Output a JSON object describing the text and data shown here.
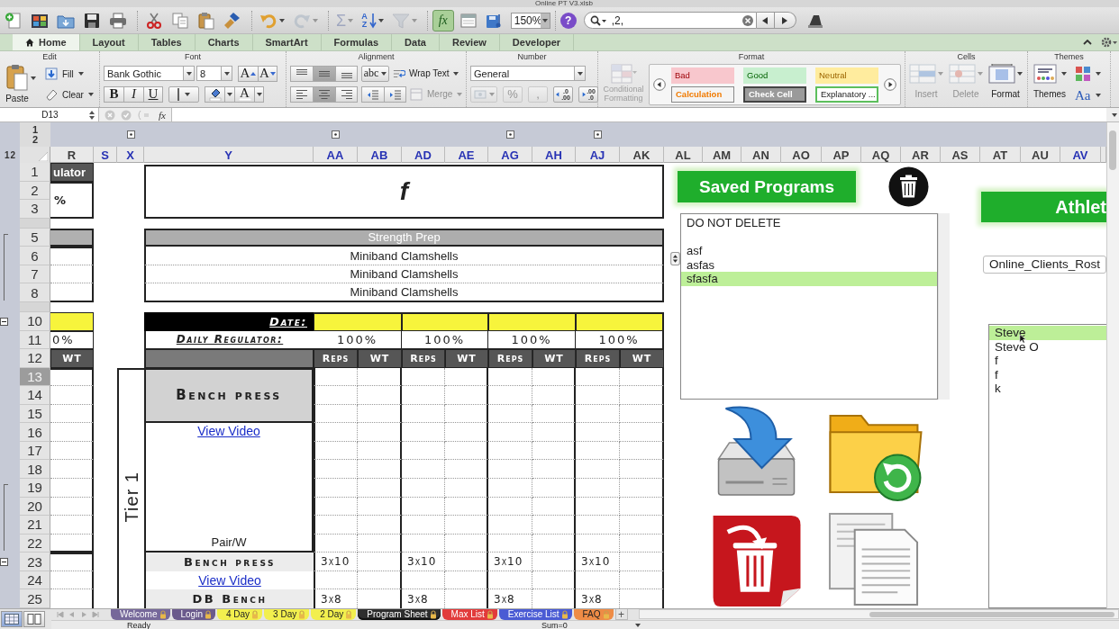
{
  "window": {
    "title": "Online PT V3.xlsb"
  },
  "toolbar": {
    "buttons": [
      {
        "kind": "new",
        "disabled": false,
        "on": false
      },
      {
        "kind": "gallery",
        "disabled": false,
        "on": false
      },
      {
        "kind": "open",
        "disabled": false,
        "on": false
      },
      {
        "kind": "save",
        "disabled": false,
        "on": false
      },
      {
        "kind": "print",
        "disabled": false,
        "on": false
      },
      {
        "kind": "cut",
        "disabled": false,
        "on": false
      },
      {
        "kind": "copy",
        "disabled": false,
        "on": false
      },
      {
        "kind": "paste",
        "disabled": false,
        "on": false
      },
      {
        "kind": "brush",
        "disabled": false,
        "on": false
      },
      {
        "kind": "undo",
        "disabled": false,
        "on": false
      },
      {
        "kind": "redo",
        "disabled": true,
        "on": false
      },
      {
        "kind": "sum",
        "label": "Σ",
        "disabled": true,
        "on": false
      },
      {
        "kind": "sort",
        "labels": [
          "A",
          "Z"
        ],
        "disabled": false,
        "on": false
      },
      {
        "kind": "filter",
        "disabled": true,
        "on": false
      },
      {
        "kind": "function",
        "label": "fx",
        "disabled": false,
        "on": true
      },
      {
        "kind": "toolbox",
        "disabled": false,
        "on": false
      },
      {
        "kind": "media",
        "disabled": false,
        "on": false
      }
    ],
    "zoom": "150%",
    "help": "?",
    "search": {
      "value": ",2,"
    },
    "end_buttons": [
      {
        "kind": "macro",
        "disabled": false,
        "on": false
      }
    ]
  },
  "ribbon_tabs": [
    {
      "label": "Home",
      "selected": true
    },
    {
      "label": "Layout",
      "selected": false
    },
    {
      "label": "Tables",
      "selected": false
    },
    {
      "label": "Charts",
      "selected": false
    },
    {
      "label": "SmartArt",
      "selected": false
    },
    {
      "label": "Formulas",
      "selected": false
    },
    {
      "label": "Data",
      "selected": false
    },
    {
      "label": "Review",
      "selected": false
    },
    {
      "label": "Developer",
      "selected": false
    }
  ],
  "ribbon": {
    "edit": {
      "title": "Edit",
      "paste": "Paste",
      "fill": "Fill",
      "clear": "Clear"
    },
    "font": {
      "title": "Font",
      "family": "Bank Gothic",
      "size": "8",
      "grow": "A",
      "shrink": "A",
      "bold": "B",
      "italic": "I",
      "underline": "U",
      "foreground": "A"
    },
    "alignment": {
      "title": "Alignment",
      "vertical": [
        {
          "kind": "top",
          "selected": false
        },
        {
          "kind": "middle",
          "selected": true
        },
        {
          "kind": "bottom",
          "selected": false
        }
      ],
      "horizontal": [
        {
          "kind": "left",
          "selected": false
        },
        {
          "kind": "center",
          "selected": true
        },
        {
          "kind": "right",
          "selected": false
        }
      ],
      "orientation": "abc",
      "wrap": "Wrap Text",
      "merge": {
        "label": "Merge",
        "disabled": true
      }
    },
    "number": {
      "title": "Number",
      "format": "General",
      "currency": {
        "disabled": true
      },
      "percent": {
        "label": "%",
        "disabled": true
      },
      "comma": {
        "label": ",",
        "disabled": true
      },
      "decimals": [
        {
          "top": ".0",
          "bottom": ".00"
        },
        {
          "top": ".00",
          "bottom": ".0"
        }
      ]
    },
    "format": {
      "title": "Format",
      "conditional": {
        "label": "Conditional Formatting",
        "disabled": true
      },
      "styles": [
        {
          "label": "Bad",
          "kind": "bad"
        },
        {
          "label": "Good",
          "kind": "good"
        },
        {
          "label": "Neutral",
          "kind": "neutral"
        },
        {
          "label": "Calculation",
          "kind": "calculation"
        },
        {
          "label": "Check Cell",
          "kind": "check"
        },
        {
          "label": "Explanatory ...",
          "kind": "explanatory"
        }
      ]
    },
    "cells": {
      "title": "Cells",
      "buttons": [
        {
          "kind": "insert",
          "label": "Insert",
          "disabled": true
        },
        {
          "kind": "delete",
          "label": "Delete",
          "disabled": true
        },
        {
          "kind": "format",
          "label": "Format",
          "disabled": false
        }
      ]
    },
    "themes": {
      "title": "Themes",
      "themes": "Themes",
      "fonts": "Aa"
    }
  },
  "formula_bar": {
    "name_box": "D13",
    "fx": "fx"
  },
  "sheet": {
    "column_levels": [
      "1",
      "2"
    ],
    "row_levels": [
      "1",
      "2"
    ],
    "columns": [
      {
        "label": "R",
        "highlighted": false,
        "outline_button": false
      },
      {
        "label": "S",
        "highlighted": true,
        "outline_button": false
      },
      {
        "label": "X",
        "highlighted": true,
        "outline_button": true
      },
      {
        "label": "Y",
        "highlighted": true,
        "outline_button": false
      },
      {
        "label": "AA",
        "highlighted": true,
        "outline_button": true
      },
      {
        "label": "AB",
        "highlighted": true,
        "outline_button": false
      },
      {
        "label": "AD",
        "highlighted": true,
        "outline_button": false
      },
      {
        "label": "AE",
        "highlighted": true,
        "outline_button": false
      },
      {
        "label": "AG",
        "highlighted": true,
        "outline_button": true
      },
      {
        "label": "AH",
        "highlighted": true,
        "outline_button": false
      },
      {
        "label": "AJ",
        "highlighted": true,
        "outline_button": true
      },
      {
        "label": "AK",
        "highlighted": false,
        "outline_button": false
      },
      {
        "label": "AL",
        "highlighted": false,
        "outline_button": false
      },
      {
        "label": "AM",
        "highlighted": false,
        "outline_button": false
      },
      {
        "label": "AN",
        "highlighted": false,
        "outline_button": false
      },
      {
        "label": "AO",
        "highlighted": false,
        "outline_button": false
      },
      {
        "label": "AP",
        "highlighted": false,
        "outline_button": false
      },
      {
        "label": "AQ",
        "highlighted": false,
        "outline_button": false
      },
      {
        "label": "AR",
        "highlighted": false,
        "outline_button": false
      },
      {
        "label": "AS",
        "highlighted": false,
        "outline_button": false
      },
      {
        "label": "AT",
        "highlighted": false,
        "outline_button": false
      },
      {
        "label": "AU",
        "highlighted": false,
        "outline_button": false
      },
      {
        "label": "AV",
        "highlighted": true,
        "outline_button": false
      }
    ],
    "rows": [
      {
        "label": "1",
        "selected": false,
        "hidden": false,
        "grouped": false,
        "collapse_button": false
      },
      {
        "label": "2",
        "selected": false,
        "hidden": false,
        "grouped": false,
        "collapse_button": false
      },
      {
        "label": "3",
        "selected": false,
        "hidden": false,
        "grouped": false,
        "collapse_button": false
      },
      {
        "selected": false,
        "hidden": true,
        "grouped": false,
        "collapse_button": false
      },
      {
        "label": "5",
        "selected": false,
        "hidden": false,
        "grouped": true,
        "collapse_button": false
      },
      {
        "label": "6",
        "selected": false,
        "hidden": false,
        "grouped": true,
        "collapse_button": false
      },
      {
        "label": "7",
        "selected": false,
        "hidden": false,
        "grouped": true,
        "collapse_button": false
      },
      {
        "label": "8",
        "selected": false,
        "hidden": false,
        "grouped": true,
        "collapse_button": false
      },
      {
        "selected": false,
        "hidden": true,
        "grouped": false,
        "collapse_button": false
      },
      {
        "label": "10",
        "selected": false,
        "hidden": false,
        "grouped": false,
        "collapse_button": true
      },
      {
        "label": "11",
        "selected": false,
        "hidden": false,
        "grouped": false,
        "collapse_button": false
      },
      {
        "label": "12",
        "selected": false,
        "hidden": false,
        "grouped": false,
        "collapse_button": false
      },
      {
        "label": "13",
        "selected": true,
        "hidden": false,
        "grouped": false,
        "collapse_button": false
      },
      {
        "label": "14",
        "selected": false,
        "hidden": false,
        "grouped": false,
        "collapse_button": false
      },
      {
        "label": "15",
        "selected": false,
        "hidden": false,
        "grouped": false,
        "collapse_button": false
      },
      {
        "label": "16",
        "selected": false,
        "hidden": false,
        "grouped": false,
        "collapse_button": false
      },
      {
        "label": "17",
        "selected": false,
        "hidden": false,
        "grouped": false,
        "collapse_button": false
      },
      {
        "label": "18",
        "selected": false,
        "hidden": false,
        "grouped": false,
        "collapse_button": false
      },
      {
        "label": "19",
        "selected": false,
        "hidden": false,
        "grouped": true,
        "collapse_button": false
      },
      {
        "label": "20",
        "selected": false,
        "hidden": false,
        "grouped": true,
        "collapse_button": false
      },
      {
        "label": "21",
        "selected": false,
        "hidden": false,
        "grouped": true,
        "collapse_button": false
      },
      {
        "label": "22",
        "selected": false,
        "hidden": false,
        "grouped": true,
        "collapse_button": false
      },
      {
        "label": "23",
        "selected": false,
        "hidden": false,
        "grouped": false,
        "collapse_button": true
      },
      {
        "label": "24",
        "selected": false,
        "hidden": false,
        "grouped": false,
        "collapse_button": false
      },
      {
        "label": "25",
        "selected": false,
        "hidden": false,
        "grouped": false,
        "collapse_button": false
      }
    ],
    "regulator": {
      "header": "ulator",
      "value": "%",
      "daily": "0%",
      "column_header": "WT"
    },
    "title_cell": "f",
    "warmup": {
      "header": "Strength Prep",
      "items": [
        "Miniband Clamshells",
        "Miniband Clamshells",
        "Miniband Clamshells"
      ]
    },
    "date_label": "Date:",
    "regulator_label": "Daily Regulator:",
    "weeks": [
      {
        "regulator": "100%",
        "columns": [
          "Reps",
          "WT"
        ]
      },
      {
        "regulator": "100%",
        "columns": [
          "Reps",
          "WT"
        ]
      },
      {
        "regulator": "100%",
        "columns": [
          "Reps",
          "WT"
        ]
      },
      {
        "regulator": "100%",
        "columns": [
          "Reps",
          "WT"
        ]
      }
    ],
    "tier": {
      "label": "Tier 1",
      "exercises": [
        {
          "kind": "header",
          "name": "Bench press",
          "link": "View Video",
          "note": "Pair/W"
        },
        {
          "kind": "row",
          "name": "Bench press",
          "sets": [
            "3x10",
            "3x10",
            "3x10",
            "3x10"
          ]
        },
        {
          "kind": "link",
          "link": "View Video"
        },
        {
          "kind": "row",
          "name": "DB Bench",
          "sets": [
            "3x8",
            "3x8",
            "3x8",
            "3x8"
          ]
        }
      ]
    }
  },
  "objects": {
    "saved_programs": {
      "label": "Saved Programs"
    },
    "programs_list": {
      "items": [
        {
          "kind": "text",
          "label": "DO NOT DELETE",
          "selected": false
        },
        {
          "kind": "blank",
          "selected": false
        },
        {
          "kind": "text",
          "label": "asf",
          "selected": false
        },
        {
          "kind": "text",
          "label": "asfas",
          "selected": false
        },
        {
          "kind": "text",
          "label": "sfasfa",
          "selected": true
        }
      ]
    },
    "athletes": {
      "label": "Athlet"
    },
    "roster_combo": {
      "value": "Online_Clients_Rost"
    },
    "athletes_list": {
      "items": [
        {
          "label": "Steve",
          "selected": true
        },
        {
          "label": "Steve O",
          "selected": false
        },
        {
          "label": "f",
          "selected": false
        },
        {
          "label": "f",
          "selected": false
        },
        {
          "label": "k",
          "selected": false
        }
      ]
    }
  },
  "sheet_tabs": {
    "tabs": [
      {
        "label": "Welcome",
        "color": "#76689a",
        "selected": false,
        "locked": true
      },
      {
        "label": "Login",
        "color": "#6a5a8c",
        "selected": false,
        "locked": true
      },
      {
        "label": "4 Day",
        "color": "#f2ef4e",
        "selected": false,
        "locked": true
      },
      {
        "label": "3 Day",
        "color": "#f2ef4e",
        "selected": false,
        "locked": true
      },
      {
        "label": "2 Day",
        "color": "#f2ef4e",
        "selected": false,
        "locked": true
      },
      {
        "label": "Program Sheet",
        "color": "#2e2e2e",
        "selected": true,
        "locked": true
      },
      {
        "label": "Max List",
        "color": "#e23b3b",
        "selected": false,
        "locked": true
      },
      {
        "label": "Exercise List",
        "color": "#4a5bd4",
        "selected": false,
        "locked": true
      },
      {
        "label": "FAQ",
        "color": "#ee8c46",
        "selected": false,
        "locked": true
      }
    ],
    "add": "+"
  },
  "status_bar": {
    "views": [
      {
        "kind": "normal",
        "selected": true
      },
      {
        "kind": "layout",
        "selected": false
      }
    ],
    "mode": "Ready",
    "sum": "Sum=0"
  }
}
